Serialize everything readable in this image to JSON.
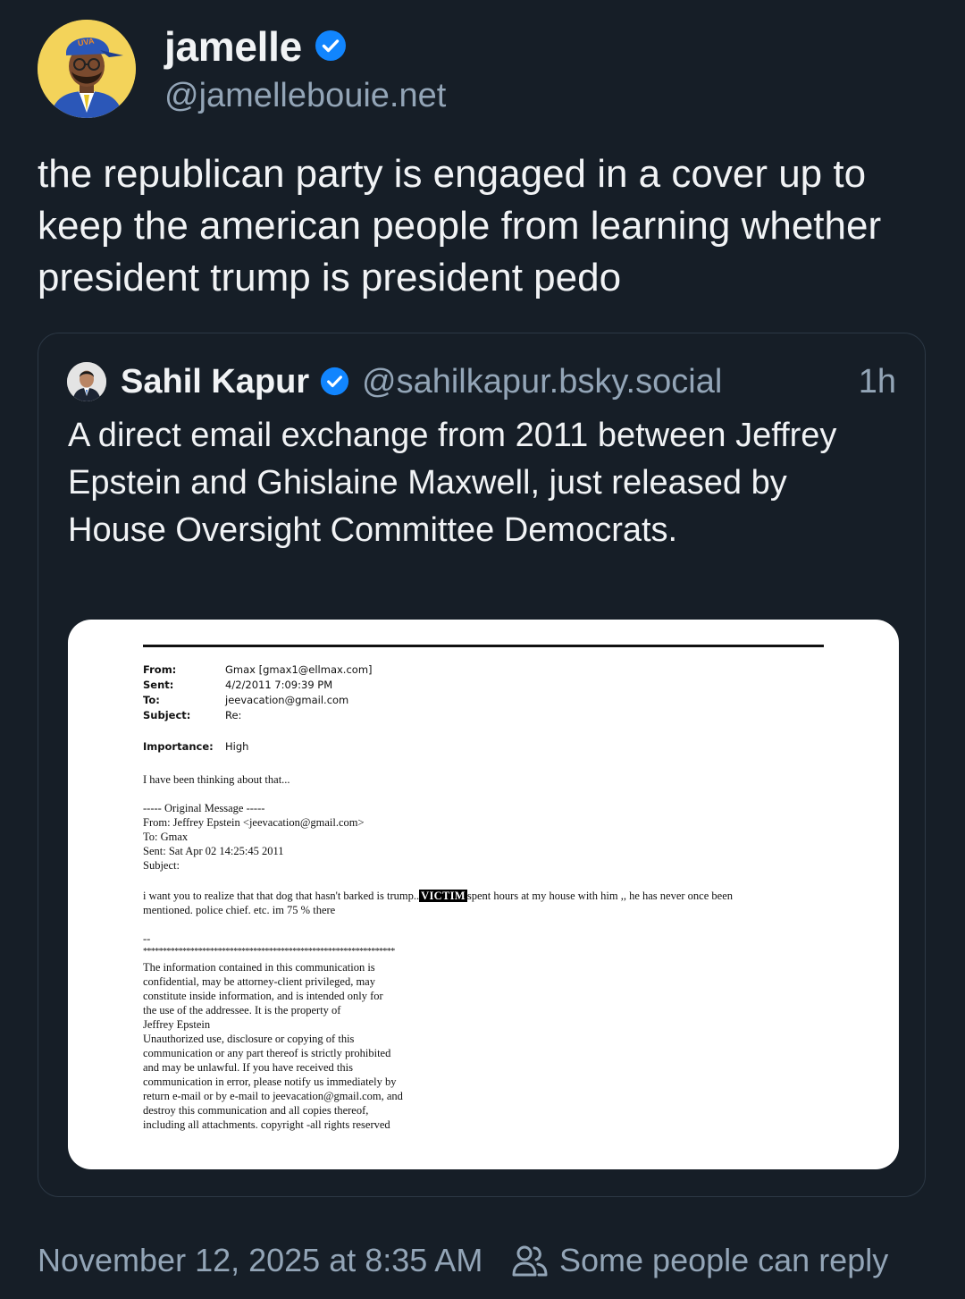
{
  "post": {
    "author": {
      "display_name": "jamelle",
      "handle": "@jamellebouie.net",
      "verified": true,
      "avatar": "cartoon-avatar-icon",
      "avatar_cap_text": "UVA"
    },
    "text": "the republican party is engaged in a cover up to keep the american people from learning whether president trump is president pedo",
    "timestamp": "November 12, 2025 at 8:35 AM",
    "reply_setting": "Some people can reply",
    "reply_setting_icon": "people-icon"
  },
  "quote": {
    "display_name": "Sahil Kapur",
    "handle": "@sahilkapur.bsky.social",
    "time_ago": "1h",
    "verified": true,
    "text": "A direct email exchange from 2011 between Jeffrey Epstein and Ghislaine Maxwell, just released by House Oversight Committee Democrats.",
    "image": {
      "headers": [
        {
          "label": "From:",
          "value": "Gmax [gmax1@ellmax.com]"
        },
        {
          "label": "Sent:",
          "value": "4/2/2011 7:09:39 PM"
        },
        {
          "label": "To:",
          "value": "jeevacation@gmail.com"
        },
        {
          "label": "Subject:",
          "value": "Re:"
        }
      ],
      "importance_label": "Importance:",
      "importance_value": "High",
      "reply_line": "I have been thinking about that...",
      "original_lines": [
        "----- Original Message -----",
        "From: Jeffrey Epstein <jeevacation@gmail.com>",
        "To: Gmax",
        "Sent: Sat Apr 02 14:25:45 2011",
        "Subject:"
      ],
      "body_part1": "i want you to realize that that dog that hasn't barked is trump..",
      "redaction_label": "VICTIM",
      "body_part2": "spent hours at my house with him ,, he has never once been",
      "body_line2": "mentioned.   police chief. etc.   im 75 % there",
      "sig_dashes": "--",
      "sig_stars": "****************************************************************",
      "disclaimer_lines": [
        "The information contained in this communication is",
        "confidential, may be attorney-client privileged, may",
        "constitute inside information, and is intended only for",
        "the use of the addressee. It is the property of",
        "Jeffrey Epstein",
        "Unauthorized use, disclosure or copying of this",
        "communication or any part thereof is strictly prohibited",
        "and may be unlawful. If you have received this",
        "communication in error, please notify us immediately by",
        "return e-mail or by e-mail to jeevacation@gmail.com, and",
        "destroy this communication and all copies thereof,",
        "including all attachments. copyright -all rights reserved"
      ]
    }
  },
  "colors": {
    "background": "#161e27",
    "primary_text": "#f1f3f5",
    "secondary_text": "#93a5b7",
    "verified_badge": "#1185fe",
    "card_border": "#2c3845"
  }
}
